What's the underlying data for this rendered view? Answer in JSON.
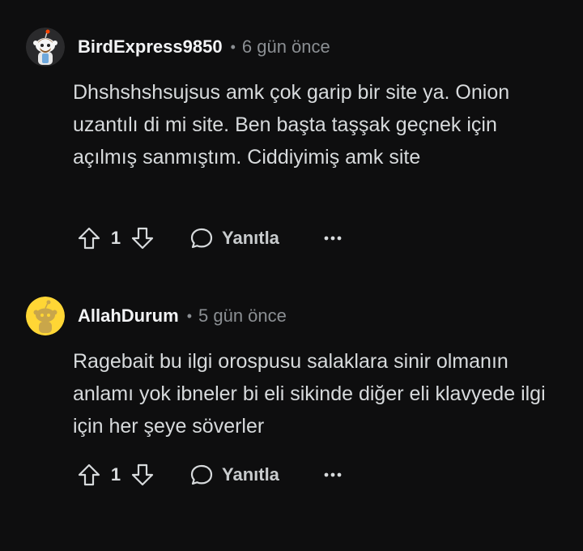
{
  "comments": [
    {
      "username": "BirdExpress9850",
      "separator": "•",
      "timestamp": "6 gün önce",
      "avatar_icon": "snoo-avatar-icon",
      "body": "Dhshshshsujsus amk çok garip bir site ya. Onion uzantılı di mi site. Ben başta taşşak geçnek için açılmış sanmıştım. Ciddiyimiş amk site",
      "vote_count": "1",
      "reply_label": "Yanıtla"
    },
    {
      "username": "AllahDurum",
      "separator": "•",
      "timestamp": "5 gün önce",
      "avatar_icon": "snoo-avatar-icon",
      "body": "Ragebait bu ilgi orospusu salaklara sinir olmanın anlamı yok ibneler bi eli sikinde diğer eli klavyede ilgi için her şeye söverler",
      "vote_count": "1",
      "reply_label": "Yanıtla"
    }
  ],
  "colors": {
    "background": "#0e0e0f",
    "text": "#d7dadc",
    "muted": "#8b8f93",
    "avatar1_bg": "#1a1a1b",
    "avatar2_bg": "#ffd635"
  }
}
